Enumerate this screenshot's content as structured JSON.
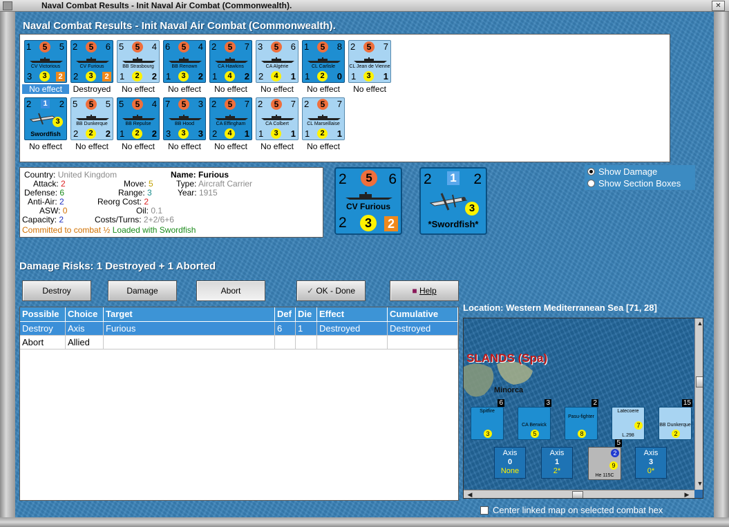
{
  "window": {
    "title": "Naval Combat Results - Init Naval Air Combat (Commonwealth)."
  },
  "header": {
    "title": "Naval Combat Results - Init Naval Air Combat (Commonwealth)."
  },
  "units_row1": [
    {
      "top_left": "1",
      "circle": "5",
      "top_right": "5",
      "name": "CV Victorious",
      "bottom_left": "3",
      "yellow": "3",
      "bottom_right": "2",
      "result": "No effect",
      "selected": true
    },
    {
      "top_left": "2",
      "circle": "5",
      "top_right": "6",
      "name": "CV Furious",
      "bottom_left": "2",
      "yellow": "3",
      "bottom_right": "2",
      "result": "Destroyed"
    },
    {
      "top_left": "5",
      "circle": "5",
      "top_right": "4",
      "name": "BB Strasbourg",
      "bottom_left": "1",
      "yellow": "2",
      "bottom_right": "2",
      "result": "No effect",
      "light": true
    },
    {
      "top_left": "6",
      "circle": "5",
      "top_right": "4",
      "name": "BB Renown",
      "bottom_left": "1",
      "yellow": "3",
      "bottom_right": "2",
      "result": "No effect"
    },
    {
      "top_left": "2",
      "circle": "5",
      "top_right": "7",
      "name": "CA Hawkins",
      "bottom_left": "1",
      "yellow": "4",
      "bottom_right": "2",
      "result": "No effect"
    },
    {
      "top_left": "3",
      "circle": "5",
      "top_right": "6",
      "name": "CA Algérie",
      "bottom_left": "2",
      "yellow": "4",
      "bottom_right": "1",
      "result": "No effect",
      "light": true
    },
    {
      "top_left": "1",
      "circle": "5",
      "top_right": "8",
      "name": "CL Carlisle",
      "bottom_left": "1",
      "yellow": "2",
      "bottom_right": "0",
      "result": "No effect"
    },
    {
      "top_left": "2",
      "circle": "5",
      "top_right": "7",
      "name": "CL Jean de Vienne",
      "bottom_left": "1",
      "yellow": "3",
      "bottom_right": "1",
      "result": "No effect",
      "light": true
    }
  ],
  "units_row2": [
    {
      "top_left": "2",
      "square": "1",
      "top_right": "2",
      "name": "Swordfish",
      "yellow": "3",
      "result": "No effect",
      "air": true
    },
    {
      "top_left": "5",
      "circle": "5",
      "top_right": "5",
      "name": "BB Dunkerque",
      "bottom_left": "2",
      "yellow": "2",
      "bottom_right": "2",
      "result": "No effect",
      "light": true
    },
    {
      "top_left": "5",
      "circle": "5",
      "top_right": "4",
      "name": "BB Repulse",
      "bottom_left": "1",
      "yellow": "2",
      "bottom_right": "2",
      "result": "No effect"
    },
    {
      "top_left": "7",
      "circle": "5",
      "top_right": "3",
      "name": "BB Hood",
      "bottom_left": "3",
      "yellow": "3",
      "bottom_right": "3",
      "result": "No effect"
    },
    {
      "top_left": "2",
      "circle": "5",
      "top_right": "7",
      "name": "CA Effingham",
      "bottom_left": "2",
      "yellow": "4",
      "bottom_right": "1",
      "result": "No effect"
    },
    {
      "top_left": "2",
      "circle": "5",
      "top_right": "7",
      "name": "CA Colbert",
      "bottom_left": "1",
      "yellow": "3",
      "bottom_right": "1",
      "result": "No effect",
      "light": true
    },
    {
      "top_left": "2",
      "circle": "5",
      "top_right": "7",
      "name": "CL Marseillaise",
      "bottom_left": "1",
      "yellow": "2",
      "bottom_right": "1",
      "result": "No effect",
      "light": true
    }
  ],
  "info": {
    "country_label": "Country:",
    "country": "United Kingdom",
    "attack_label": "Attack:",
    "attack": "2",
    "defense_label": "Defense:",
    "defense": "6",
    "antiair_label": "Anti-Air:",
    "antiair": "2",
    "asw_label": "ASW:",
    "asw": "0",
    "capacity_label": "Capacity:",
    "capacity": "2",
    "move_label": "Move:",
    "move": "5",
    "range_label": "Range:",
    "range": "3",
    "reorg_label": "Reorg Cost:",
    "reorg": "2",
    "oil_label": "Oil:",
    "oil": "0.1",
    "costs_label": "Costs/Turns:",
    "costs": "2+2/6+6",
    "name_label": "Name:",
    "name": "Furious",
    "type_label": "Type:",
    "type": "Aircraft Carrier",
    "year_label": "Year:",
    "year": "1915",
    "committed": "Committed to combat ½",
    "loaded": "Loaded with Swordfish"
  },
  "big_ship": {
    "tl": "2",
    "circle": "5",
    "tr": "6",
    "name": "CV Furious",
    "bl": "2",
    "yellow": "3",
    "br": "2"
  },
  "big_air": {
    "tl": "2",
    "square": "1",
    "tr": "2",
    "yellow": "3",
    "name": "*Swordfish*"
  },
  "options": {
    "show_damage": "Show Damage",
    "show_section": "Show Section Boxes"
  },
  "damage_risks": "Damage Risks: 1 Destroyed + 1 Aborted",
  "buttons": {
    "destroy": "Destroy",
    "damage": "Damage",
    "abort": "Abort",
    "ok": "OK - Done",
    "help": "Help"
  },
  "table": {
    "headers": [
      "Possible",
      "Choice",
      "Target",
      "Def",
      "Die",
      "Effect",
      "Cumulative"
    ],
    "rows": [
      [
        "Destroy",
        "Axis",
        "Furious",
        "6",
        "1",
        "Destroyed",
        "Destroyed"
      ],
      [
        "Abort",
        "Allied",
        "",
        "",
        "",
        "",
        ""
      ]
    ]
  },
  "location": "Location:  Western Mediterranean Sea [71, 28]",
  "map": {
    "region_label": "SLANDS (Spa)",
    "island_label": "Minorca",
    "units": [
      {
        "name": "Spitfire",
        "badge": "6",
        "yellow": "3"
      },
      {
        "name": "CA Berwick",
        "badge": "3",
        "yellow": "5"
      },
      {
        "name": "Pasu-fighter",
        "badge": "2",
        "yellow": "8"
      },
      {
        "name": "Latecoere",
        "badge": "",
        "yellow": "7",
        "label2": "L.298"
      },
      {
        "name": "BB Dunkerque",
        "badge": "15",
        "yellow": "2"
      }
    ],
    "axis_boxes": [
      {
        "title": "Axis",
        "value": "0",
        "sub": "None"
      },
      {
        "title": "Axis",
        "value": "1",
        "sub": "2*"
      },
      {
        "title": "Axis",
        "value": "3",
        "sub": "0*"
      }
    ],
    "he115": {
      "name": "He 115C",
      "badge": "5",
      "yellow": "9",
      "circle": "2"
    }
  },
  "center_linked": "Center linked map on selected combat hex"
}
